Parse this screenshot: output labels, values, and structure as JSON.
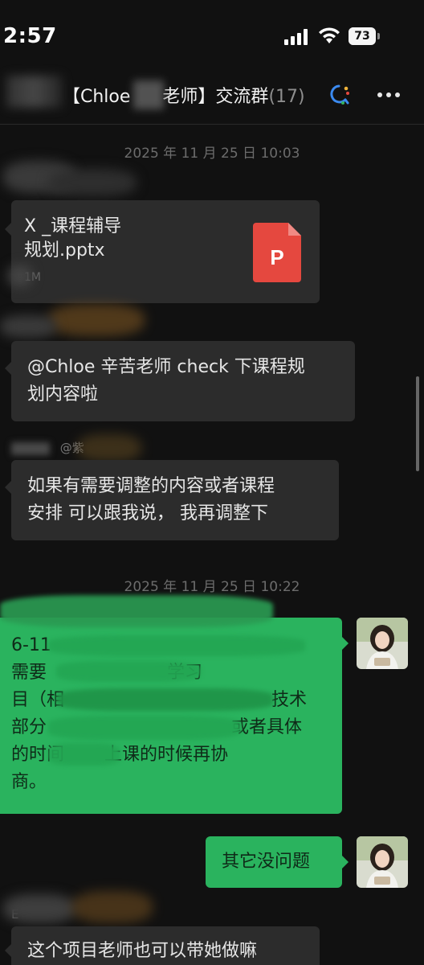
{
  "status_bar": {
    "time": "2:57",
    "battery_percent": "73",
    "battery_level": 0.73
  },
  "header": {
    "title_left": "【Chloe",
    "title_right": "老师】交流群",
    "member_count": "(17)"
  },
  "messages": {
    "ts1": "2025 年 11 月 25 日 10:03",
    "file": {
      "name_line1": "X _课程辅导",
      "name_line2": "规划.pptx",
      "size": "1M",
      "icon_letter": "P"
    },
    "msg1_line1": "@Chloe 辛苦老师 check 下课程规",
    "msg1_line2": "划内容啦",
    "msg2_line1": "如果有需要调整的内容或者课程",
    "msg2_line2": "安排 可以跟我说， 我再调整下",
    "ts2": "2025 年 11 月 25 日 10:22",
    "green_long": {
      "line1": "6-11",
      "line2": "需要",
      "line2b": "学习",
      "line3": "目（相",
      "line3b": "技术",
      "line4": "部分",
      "line4b": "或者具体",
      "line5": "的时间",
      "line5b": "上课的时候再协",
      "line6": "商。"
    },
    "green_short": "其它没问题",
    "sender_blurred": "@紫",
    "last_sender": "E",
    "last_msg": "这个项目老师也可以带她做嘛"
  },
  "colors": {
    "background": "#111111",
    "bubble_dark": "#2c2c2c",
    "bubble_green": "#2ab35e",
    "ppt_red": "#e5483f"
  }
}
